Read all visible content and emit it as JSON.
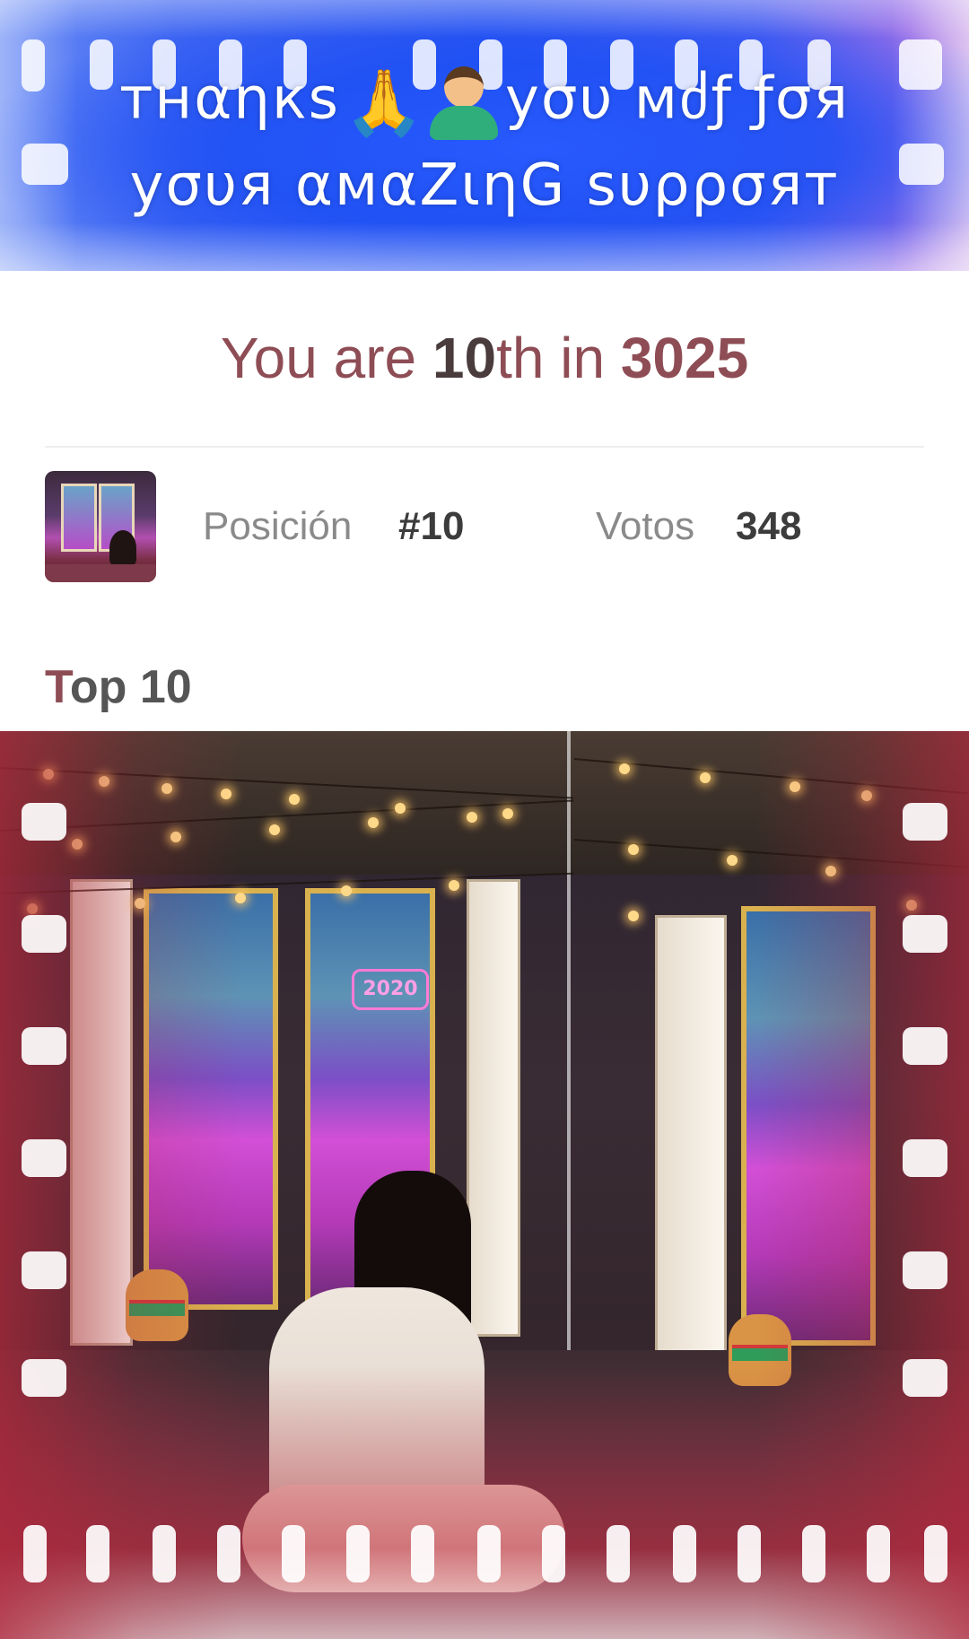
{
  "banner": {
    "line1_start": "тнαηкѕ",
    "line1_end": "уσυ мძƒ ƒσя",
    "line2": "уσυя αмαΖιηG ѕυρρσят",
    "emoji_1": "pray-emoji-icon",
    "emoji_2": "person-bowing-emoji-icon"
  },
  "rank": {
    "prefix": "You are ",
    "position_number": "10",
    "position_suffix": "th",
    "middle": " in ",
    "total": "3025"
  },
  "stats": {
    "position_label": "Posición",
    "position_value": "#10",
    "votes_label": "Votos",
    "votes_value": "348"
  },
  "section": {
    "title_first": "T",
    "title_rest": "op 10"
  },
  "poster": {
    "neon_sign": "2020"
  },
  "colors": {
    "accent": "#8e4d55",
    "dark_text": "#3c3c3c",
    "muted_text": "#8a8a8a",
    "banner_blue": "#2a54f0"
  }
}
